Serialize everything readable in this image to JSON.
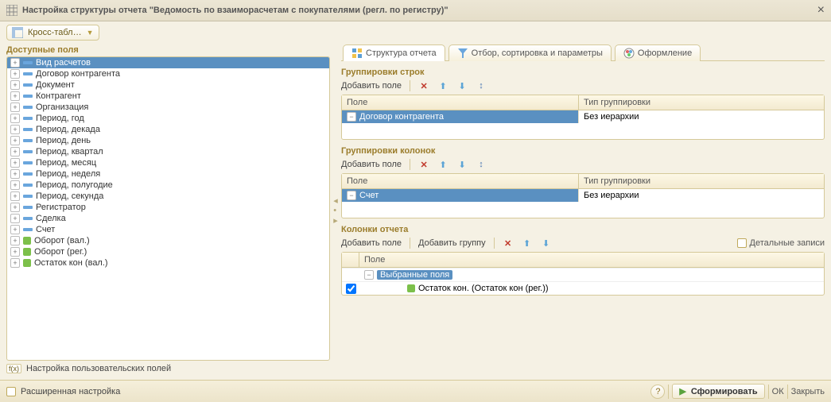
{
  "titlebar": {
    "title": "Настройка структуры отчета \"Ведомость по взаиморасчетам с покупателями (регл. по регистру)\"",
    "close": "×"
  },
  "dropdown": {
    "label": "Кросс-табл…"
  },
  "leftPane": {
    "heading": "Доступные поля",
    "userFieldsLabel": "Настройка пользовательских полей",
    "items": [
      {
        "label": "Вид расчетов",
        "icon": "dash",
        "selected": true
      },
      {
        "label": "Договор контрагента",
        "icon": "dash"
      },
      {
        "label": "Документ",
        "icon": "dash"
      },
      {
        "label": "Контрагент",
        "icon": "dash"
      },
      {
        "label": "Организация",
        "icon": "dash"
      },
      {
        "label": "Период, год",
        "icon": "dash"
      },
      {
        "label": "Период, декада",
        "icon": "dash"
      },
      {
        "label": "Период, день",
        "icon": "dash"
      },
      {
        "label": "Период, квартал",
        "icon": "dash"
      },
      {
        "label": "Период, месяц",
        "icon": "dash"
      },
      {
        "label": "Период, неделя",
        "icon": "dash"
      },
      {
        "label": "Период, полугодие",
        "icon": "dash"
      },
      {
        "label": "Период, секунда",
        "icon": "dash"
      },
      {
        "label": "Регистратор",
        "icon": "dash"
      },
      {
        "label": "Сделка",
        "icon": "dash"
      },
      {
        "label": "Счет",
        "icon": "dash"
      },
      {
        "label": "Оборот (вал.)",
        "icon": "green"
      },
      {
        "label": "Оборот (рег.)",
        "icon": "green"
      },
      {
        "label": "Остаток кон (вал.)",
        "icon": "green"
      }
    ]
  },
  "tabs": [
    {
      "label": "Структура отчета",
      "active": true,
      "icon": "structure"
    },
    {
      "label": "Отбор, сортировка и параметры",
      "icon": "funnel"
    },
    {
      "label": "Оформление",
      "icon": "palette"
    }
  ],
  "rowGroups": {
    "heading": "Группировки строк",
    "addField": "Добавить поле",
    "headers": {
      "field": "Поле",
      "type": "Тип группировки"
    },
    "rows": [
      {
        "field": "Договор контрагента",
        "type": "Без иерархии",
        "selected": true
      }
    ]
  },
  "colGroups": {
    "heading": "Группировки колонок",
    "addField": "Добавить поле",
    "headers": {
      "field": "Поле",
      "type": "Тип группировки"
    },
    "rows": [
      {
        "field": "Счет",
        "type": "Без иерархии",
        "selected": true
      }
    ]
  },
  "reportCols": {
    "heading": "Колонки отчета",
    "addField": "Добавить поле",
    "addGroup": "Добавить группу",
    "detailRecords": "Детальные записи",
    "headerField": "Поле",
    "selectedGroup": "Выбранные поля",
    "item": "Остаток кон. (Остаток кон (рег.))"
  },
  "footer": {
    "extended": "Расширенная настройка",
    "form": "Сформировать",
    "ok": "ОК",
    "close": "Закрыть"
  }
}
